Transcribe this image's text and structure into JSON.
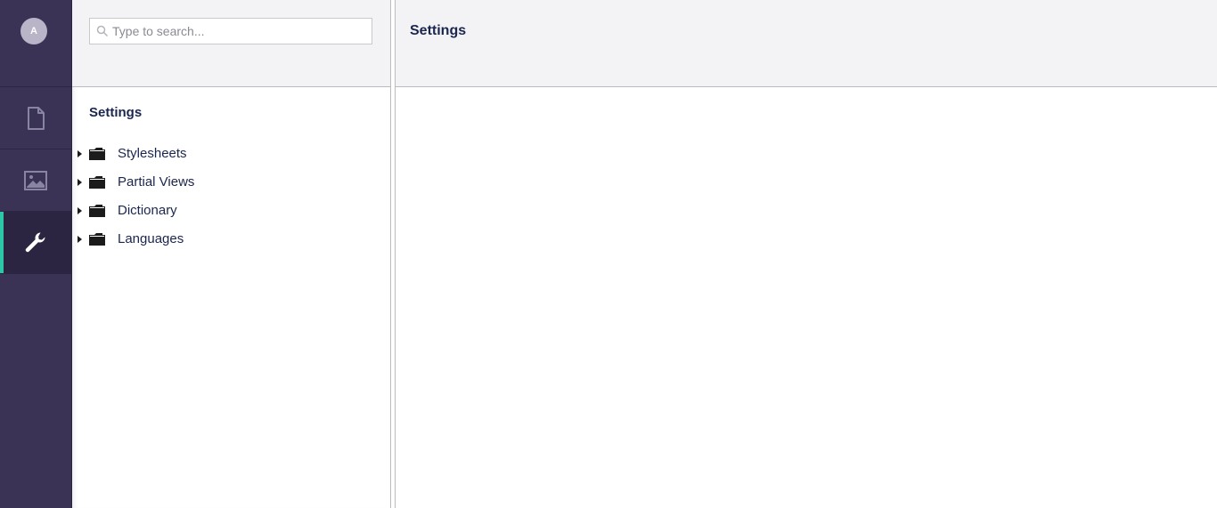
{
  "user": {
    "avatar_initial": "A"
  },
  "sections": [
    {
      "name": "Content",
      "icon": "document-icon",
      "active": false
    },
    {
      "name": "Media",
      "icon": "image-icon",
      "active": false
    },
    {
      "name": "Settings",
      "icon": "wrench-icon",
      "active": true
    }
  ],
  "tree": {
    "search_placeholder": "Type to search...",
    "search_value": "",
    "title": "Settings",
    "nodes": [
      {
        "label": "Stylesheets",
        "icon": "folder-icon",
        "expanded": false
      },
      {
        "label": "Partial Views",
        "icon": "folder-icon",
        "expanded": false
      },
      {
        "label": "Dictionary",
        "icon": "folder-icon",
        "expanded": false
      },
      {
        "label": "Languages",
        "icon": "folder-icon",
        "expanded": false
      }
    ]
  },
  "main": {
    "title": "Settings"
  },
  "colors": {
    "rail_bg": "#3a3356",
    "rail_active_bg": "#2b2542",
    "active_accent": "#2bc7a7",
    "header_bg": "#f3f3f5",
    "text": "#1b264f"
  }
}
